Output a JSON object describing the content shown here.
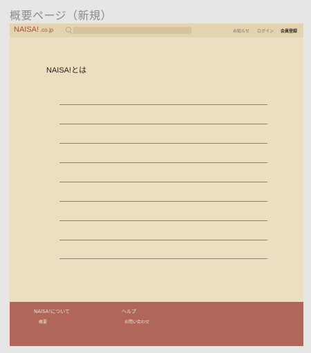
{
  "page_label": "概要ページ（新規）",
  "header": {
    "logo_main": "NAISA!",
    "logo_domain": ".co.jp",
    "search_placeholder": "",
    "nav": {
      "news": "お知らせ",
      "login": "ログイン",
      "register": "会員登録"
    }
  },
  "main": {
    "title": "NAISA!とは"
  },
  "footer": {
    "about_heading": "NAISA!について",
    "about_link": "概要",
    "help_heading": "ヘルプ",
    "help_link": "お問い合わせ"
  },
  "colors": {
    "page_bg": "#ecdec0",
    "header_bg": "#e3d3b0",
    "footer_bg": "#b0675a",
    "brand": "#b04a3a"
  }
}
